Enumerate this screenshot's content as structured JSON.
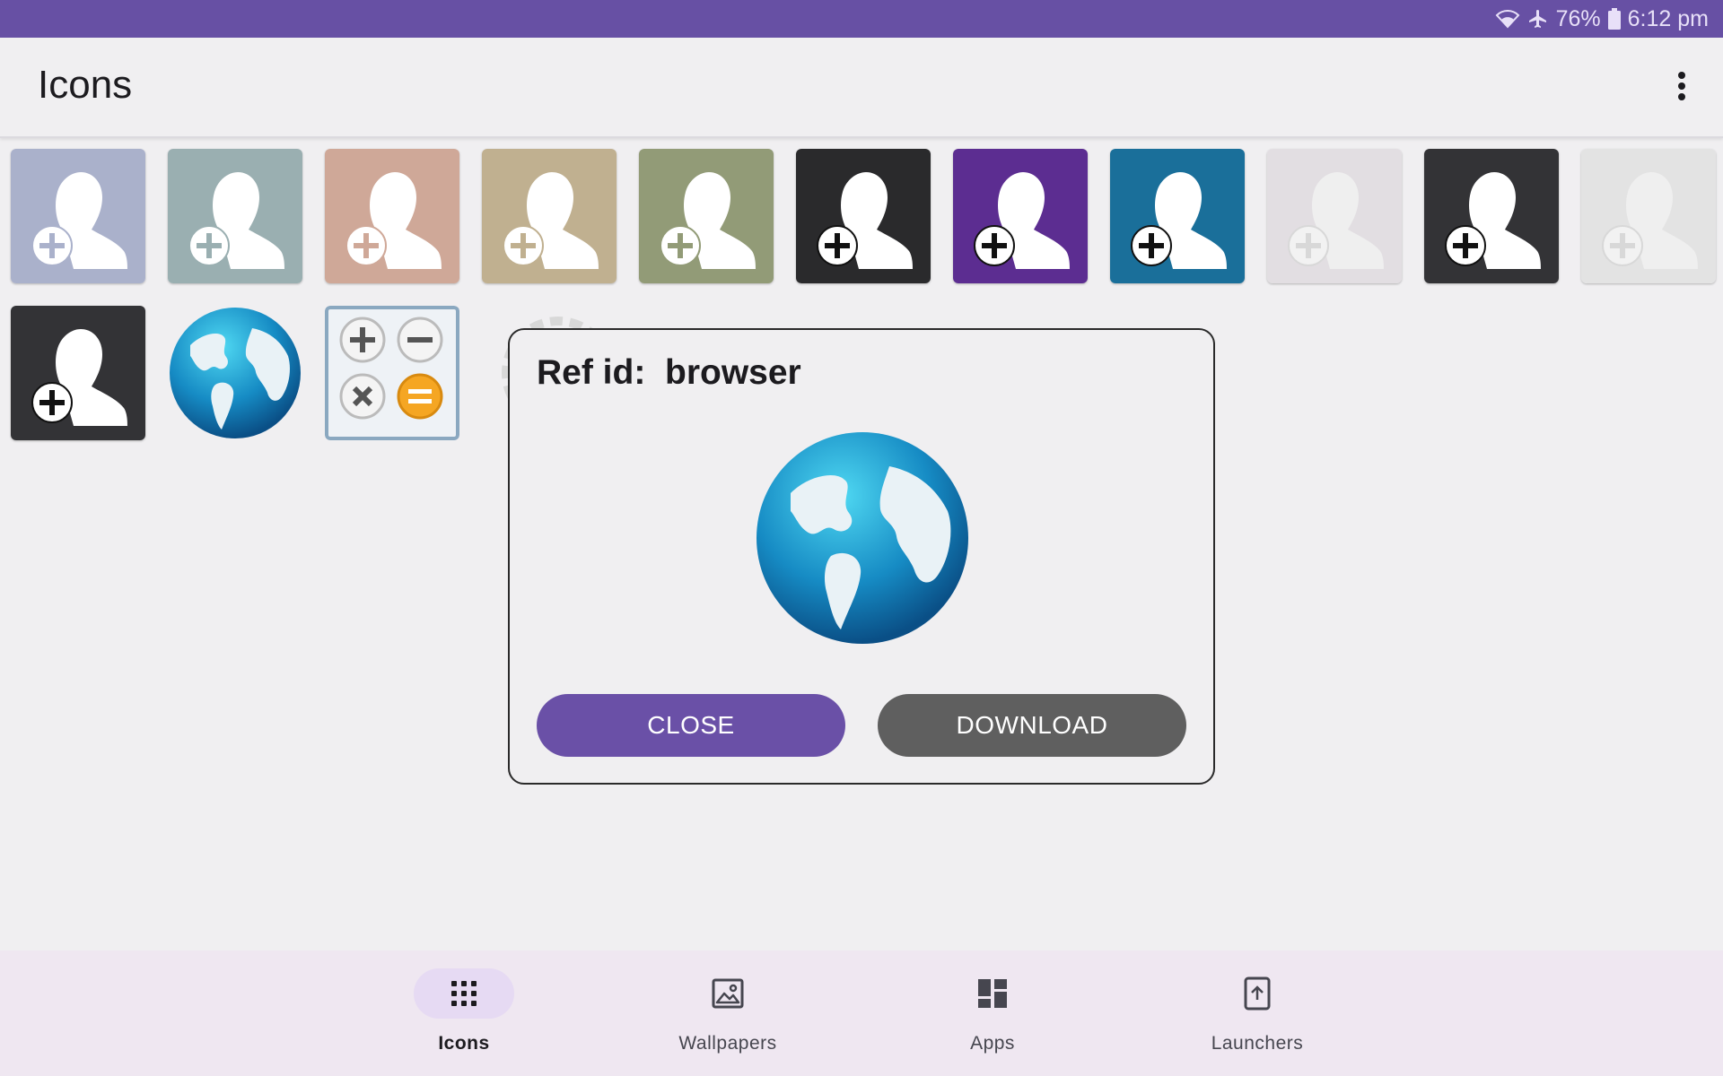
{
  "status_bar": {
    "battery": "76%",
    "time": "6:12 pm",
    "icons": [
      "wifi-icon",
      "airplane-mode-icon",
      "battery-icon"
    ]
  },
  "app_bar": {
    "title": "Icons",
    "menu_icon": "more-vert-icon"
  },
  "icon_grid": {
    "row1": [
      {
        "name": "add-contact",
        "bg": "#aab1cb"
      },
      {
        "name": "add-contact",
        "bg": "#9aafb1"
      },
      {
        "name": "add-contact",
        "bg": "#cfa898"
      },
      {
        "name": "add-contact",
        "bg": "#c0b090"
      },
      {
        "name": "add-contact",
        "bg": "#929b77"
      },
      {
        "name": "add-contact",
        "bg": "#2a2a2c"
      },
      {
        "name": "add-contact",
        "bg": "#5c2d91"
      },
      {
        "name": "add-contact",
        "bg": "#1a6f9a"
      },
      {
        "name": "add-contact",
        "bg": "#e2dee2"
      },
      {
        "name": "add-contact",
        "bg": "#333336"
      },
      {
        "name": "add-contact",
        "bg": "#e3e3e3"
      }
    ],
    "row2": [
      {
        "name": "add-contact",
        "bg": "#333336"
      },
      {
        "name": "browser",
        "bg": "transparent"
      },
      {
        "name": "calculator",
        "bg": "#e9eef3"
      },
      {
        "name": "settings",
        "bg": "transparent"
      }
    ]
  },
  "dialog": {
    "title": "Ref id:  browser",
    "preview_icon": "globe-icon",
    "close_label": "CLOSE",
    "download_label": "DOWNLOAD"
  },
  "bottom_nav": {
    "items": [
      {
        "label": "Icons",
        "icon": "apps-grid-icon",
        "active": true
      },
      {
        "label": "Wallpapers",
        "icon": "image-icon",
        "active": false
      },
      {
        "label": "Apps",
        "icon": "dashboard-icon",
        "active": false
      },
      {
        "label": "Launchers",
        "icon": "install-mobile-icon",
        "active": false
      }
    ]
  },
  "colors": {
    "primary": "#6750a4",
    "close_button": "#6a50a7",
    "download_button": "#5f5f5f"
  }
}
